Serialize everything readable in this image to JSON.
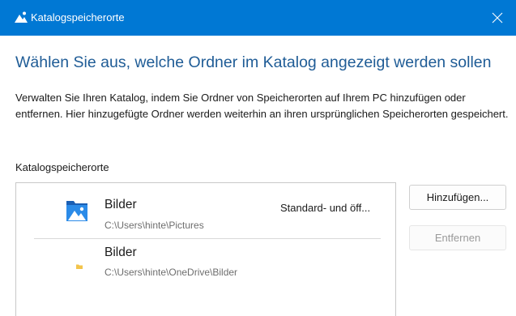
{
  "window": {
    "title": "Katalogspeicherorte",
    "accent_color": "#0078d4",
    "title_icon": "photos-app-icon",
    "close_icon": "close-icon"
  },
  "main": {
    "heading": "Wählen Sie aus, welche Ordner im Katalog angezeigt werden sollen",
    "description": "Verwalten Sie Ihren Katalog, indem Sie Ordner von Speicherorten auf Ihrem PC hinzufügen oder entfernen. Hier hinzugefügte Ordner werden weiterhin an ihren ursprünglichen Speicherorten gespeichert.",
    "locations_label": "Katalogspeicherorte"
  },
  "locations": [
    {
      "icon": "pictures-folder-icon",
      "name": "Bilder",
      "path": "C:\\Users\\hinte\\Pictures",
      "status": "Standard- und öff..."
    },
    {
      "icon": "folder-icon",
      "name": "Bilder",
      "path": "C:\\Users\\hinte\\OneDrive\\Bilder",
      "status": ""
    }
  ],
  "buttons": {
    "add_label": "Hinzufügen...",
    "remove_label": "Entfernen",
    "remove_enabled": false
  }
}
